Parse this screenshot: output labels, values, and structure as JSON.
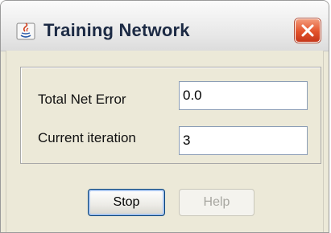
{
  "window": {
    "title": "Training Network",
    "close_icon": "close-icon",
    "app_icon": "java-app-icon"
  },
  "form": {
    "fields": [
      {
        "label": "Total Net Error",
        "value": "0.0"
      },
      {
        "label": "Current iteration",
        "value": "3"
      }
    ]
  },
  "buttons": {
    "stop_label": "Stop",
    "help_label": "Help"
  },
  "colors": {
    "close_button": "#e3532b",
    "panel_background": "#ece9d8",
    "default_button_border": "#003c74"
  }
}
